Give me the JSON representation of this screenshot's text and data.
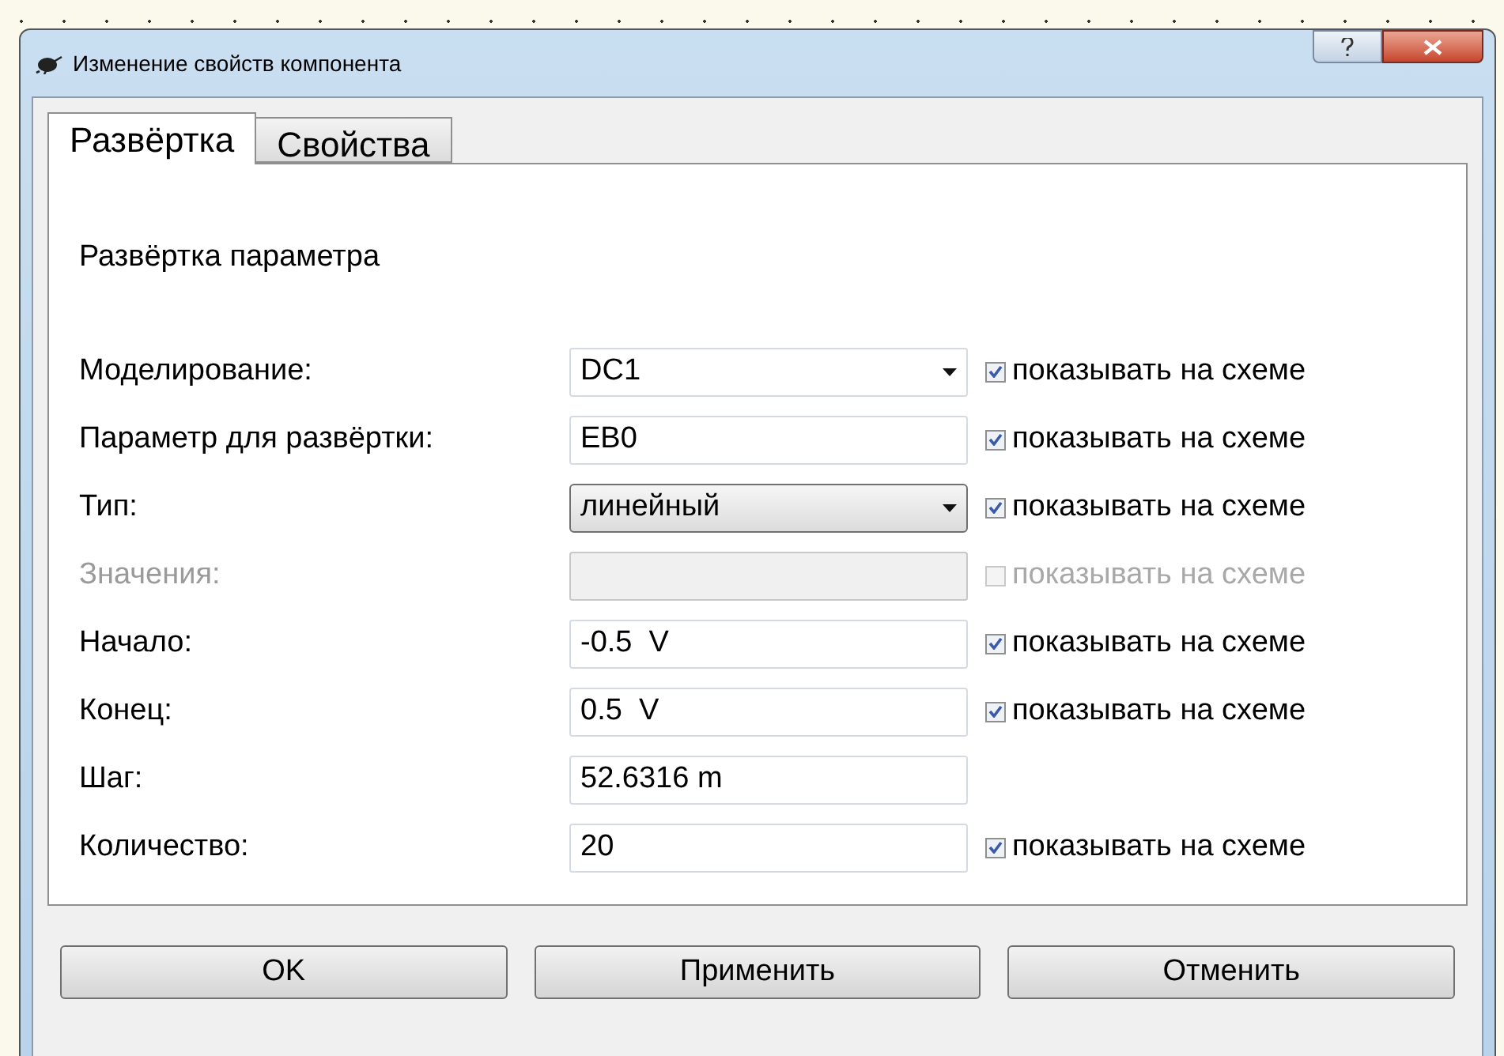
{
  "window": {
    "title": "Изменение свойств компонента"
  },
  "tabs": [
    {
      "label": "Развёртка",
      "selected": true
    },
    {
      "label": "Свойства",
      "selected": false
    }
  ],
  "section_title": "Развёртка параметра",
  "rows": [
    {
      "label": "Моделирование:",
      "kind": "dropdown",
      "value": "DC1",
      "disabled": false,
      "show": {
        "label": "показывать на схеме",
        "checked": true,
        "disabled": false
      }
    },
    {
      "label": "Параметр для развёртки:",
      "kind": "text",
      "value": "EB0",
      "disabled": false,
      "show": {
        "label": "показывать на схеме",
        "checked": true,
        "disabled": false
      }
    },
    {
      "label": "Тип:",
      "kind": "select",
      "value": "линейный",
      "disabled": false,
      "show": {
        "label": "показывать на схеме",
        "checked": true,
        "disabled": false
      }
    },
    {
      "label": "Значения:",
      "kind": "text",
      "disabled": true,
      "show": {
        "label": "показывать на схеме",
        "checked": false,
        "disabled": true
      }
    },
    {
      "label": "Начало:",
      "kind": "text",
      "value": "-0.5  V",
      "disabled": false,
      "show": {
        "label": "показывать на схеме",
        "checked": true,
        "disabled": false
      }
    },
    {
      "label": "Конец:",
      "kind": "text",
      "value": "0.5  V",
      "disabled": false,
      "show": {
        "label": "показывать на схеме",
        "checked": true,
        "disabled": false
      }
    },
    {
      "label": "Шаг:",
      "kind": "text",
      "value": "52.6316 m",
      "disabled": false
    },
    {
      "label": "Количество:",
      "kind": "text",
      "value": "20",
      "disabled": false,
      "show": {
        "label": "показывать на схеме",
        "checked": true,
        "disabled": false
      }
    }
  ],
  "buttons": [
    "OK",
    "Применить",
    "Отменить"
  ]
}
